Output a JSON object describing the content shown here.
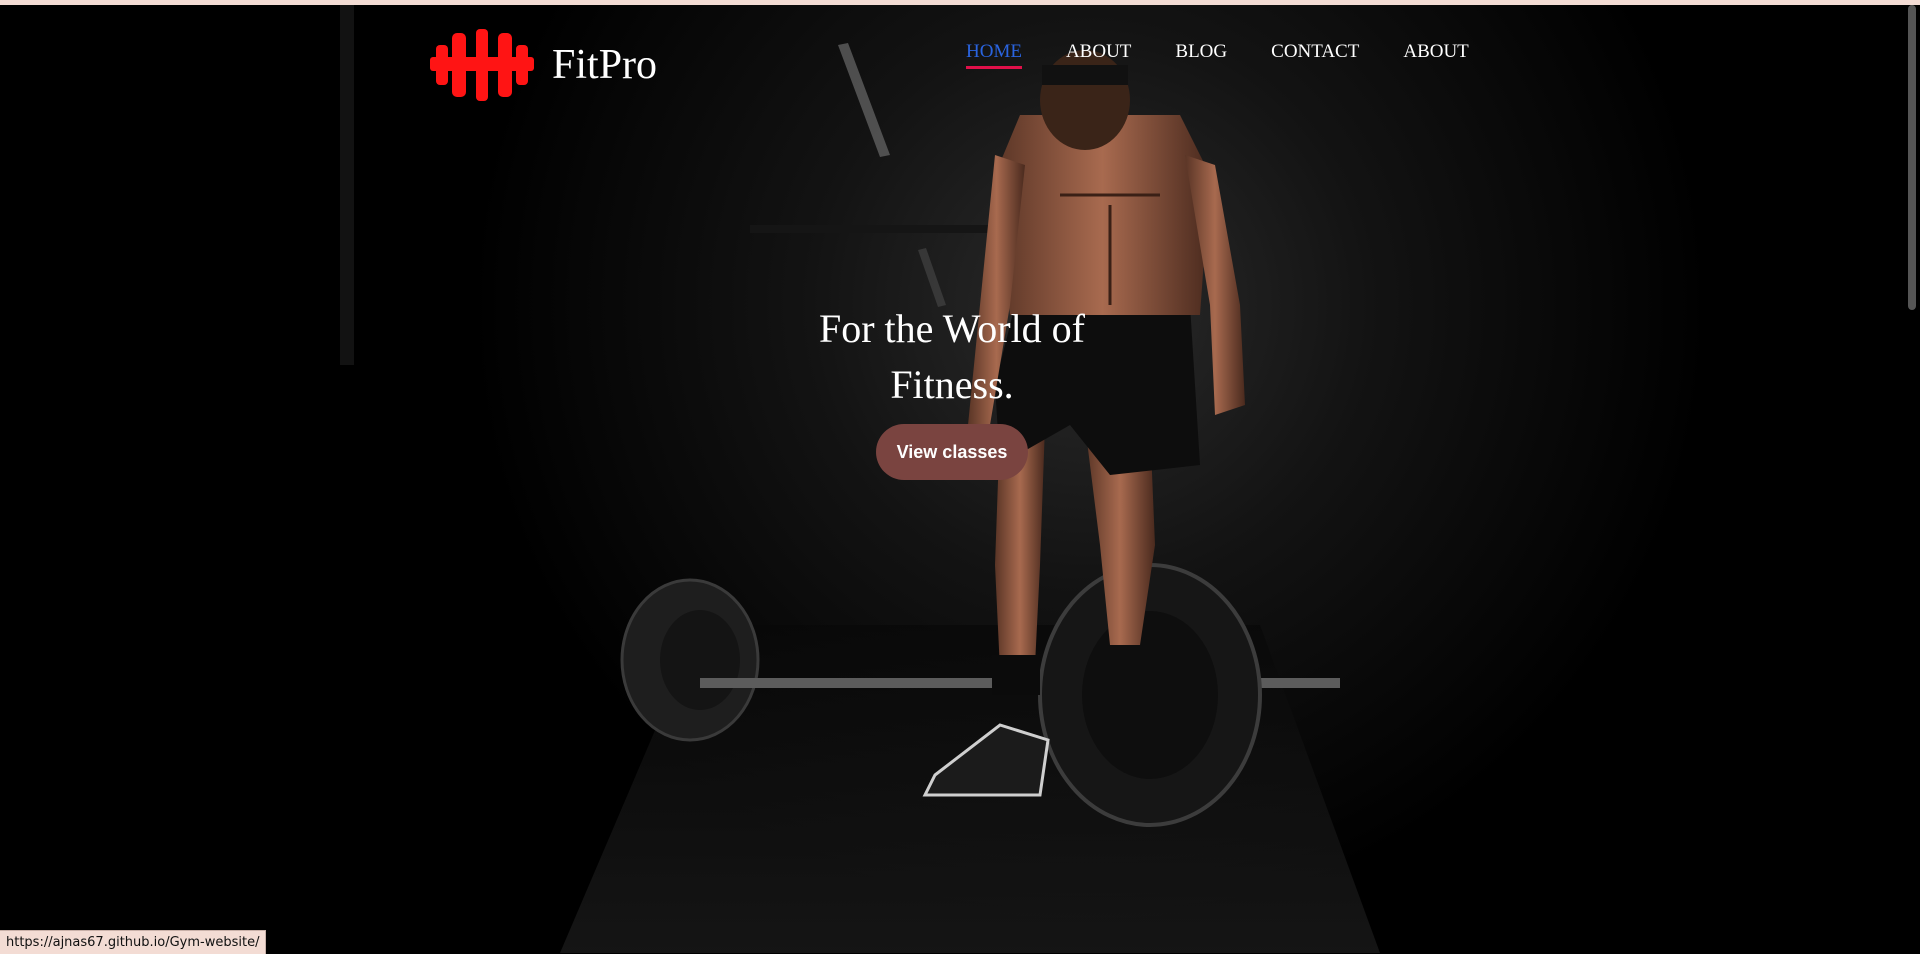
{
  "site": {
    "brand": "FitPro",
    "logo_icon": "dumbbell-icon",
    "accent": "#ff1414",
    "nav_active_color": "#2a64e0",
    "nav_underline": "#e0104a"
  },
  "nav": {
    "items": [
      {
        "label": "HOME",
        "active": true
      },
      {
        "label": "ABOUT",
        "active": false
      },
      {
        "label": "BLOG",
        "active": false
      },
      {
        "label": "CONTACT",
        "active": false
      },
      {
        "label": "ABOUT",
        "active": false
      }
    ]
  },
  "hero": {
    "headline_line1": "For the World of",
    "headline_line2": "Fitness.",
    "cta_label": "View classes",
    "cta_color": "#7a4440",
    "background": "dark gym photo of athlete standing beside loaded barbell"
  },
  "status_bar": {
    "url": "https://ajnas67.github.io/Gym-website/"
  }
}
